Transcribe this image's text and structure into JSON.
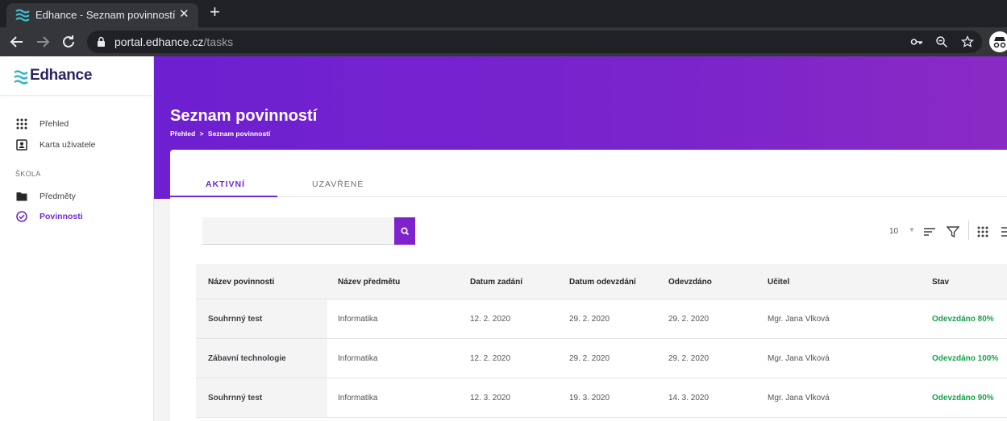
{
  "browser": {
    "tab_title": "Edhance - Seznam povinností",
    "tab_close": "✕",
    "new_tab": "+",
    "url_host": "portal.edhance.cz",
    "url_path": "/tasks"
  },
  "app": {
    "logo_text": "Edhance",
    "brand_color": "#6d28d9"
  },
  "sidebar": {
    "items": [
      {
        "label": "Přehled",
        "icon": "grid-icon"
      },
      {
        "label": "Karta uživatele",
        "icon": "user-card-icon"
      }
    ],
    "section_label": "ŠKOLA",
    "school_items": [
      {
        "label": "Předměty",
        "icon": "folder-icon"
      },
      {
        "label": "Povinnosti",
        "icon": "check-circle-icon",
        "active": true
      }
    ]
  },
  "header": {
    "title": "Seznam povinností",
    "breadcrumb": [
      "Přehled",
      ">",
      "Seznam povinností"
    ]
  },
  "tabs": [
    {
      "label": "AKTIVNÍ",
      "active": true
    },
    {
      "label": "UZAVŘENÉ",
      "active": false
    }
  ],
  "search": {
    "value": "",
    "placeholder": ""
  },
  "toolbar": {
    "page_size": "10",
    "caret": "▼"
  },
  "table": {
    "columns": [
      "Název povinnosti",
      "Název předmětu",
      "Datum zadání",
      "Datum odevzdání",
      "Odevzdáno",
      "Učitel",
      "Stav"
    ],
    "rows": [
      [
        "Souhrnný test",
        "Informatika",
        "12. 2. 2020",
        "29. 2. 2020",
        "29. 2. 2020",
        "Mgr. Jana Vlková",
        "Odevzdáno 80%"
      ],
      [
        "Zábavní technologie",
        "Informatika",
        "12. 2. 2020",
        "29. 2. 2020",
        "29. 2. 2020",
        "Mgr. Jana Vlková",
        "Odevzdáno 100%"
      ],
      [
        "Souhrnný test",
        "Informatika",
        "12. 3. 2020",
        "19. 3. 2020",
        "14. 3. 2020",
        "Mgr. Jana Vlková",
        "Odevzdáno 90%"
      ]
    ]
  }
}
